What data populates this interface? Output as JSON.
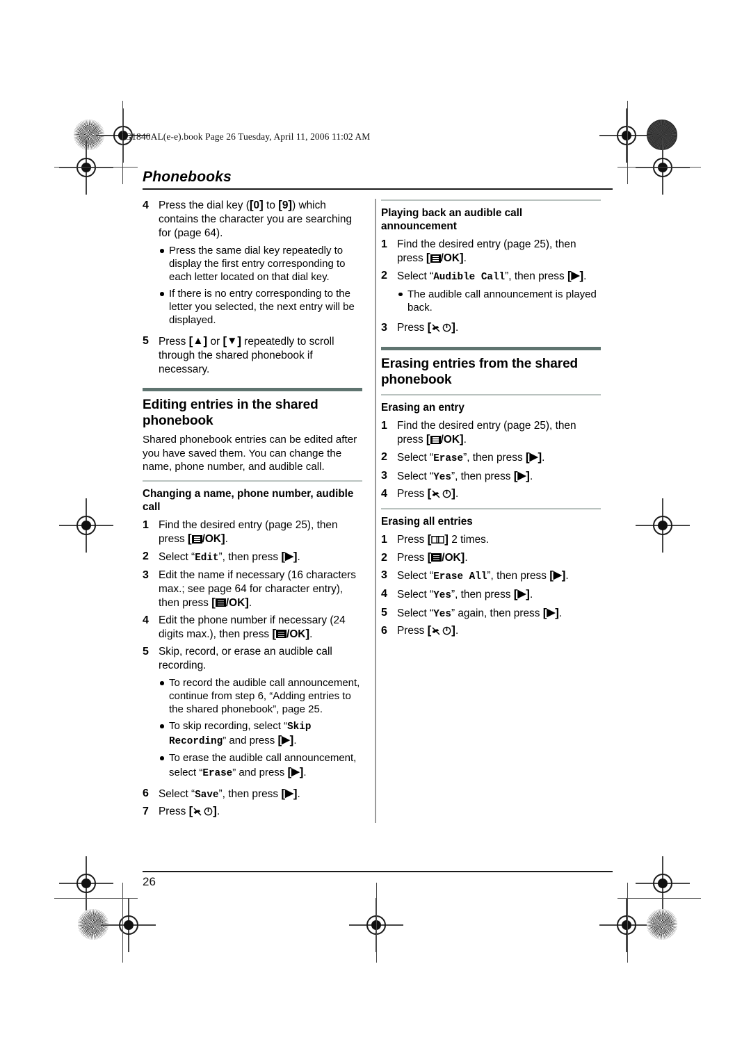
{
  "document": {
    "file_header": "TG1840AL(e-e).book  Page 26  Tuesday, April 11, 2006  11:02 AM",
    "running_head": "Phonebooks",
    "page_number": "26"
  },
  "colors": {
    "section_rule": "#5f7470",
    "sub_rule": "#b9c2bf",
    "text": "#000000",
    "column_divider": "#9a9a9a"
  },
  "left_column": {
    "continued_steps": [
      {
        "num": "4",
        "text_before": "Press the dial key (",
        "key_a": "0",
        "text_mid": " to ",
        "key_b": "9",
        "text_after": ") which contains the character you are searching for (page 64).",
        "bullets": [
          "Press the same dial key repeatedly to display the first entry corresponding to each letter located on that dial key.",
          "If there is no entry corresponding to the letter you selected, the next entry will be displayed."
        ]
      },
      {
        "num": "5",
        "text_before": "Press ",
        "text_mid": " or ",
        "text_after": " repeatedly to scroll through the shared phonebook if necessary."
      }
    ],
    "section": {
      "title": "Editing entries in the shared phonebook",
      "intro": "Shared phonebook entries can be edited after you have saved them. You can change the name, phone number, and audible call.",
      "subsection_title": "Changing a name, phone number, audible call",
      "steps": [
        {
          "num": "1",
          "before": "Find the desired entry (page 25), then press ",
          "after": "."
        },
        {
          "num": "2",
          "before": "Select “",
          "mono": "Edit",
          "mid": "”, then press ",
          "after": "."
        },
        {
          "num": "3",
          "before": "Edit the name if necessary (16 characters max.; see page 64 for character entry), then press ",
          "after": "."
        },
        {
          "num": "4",
          "before": "Edit the phone number if necessary (24 digits max.), then press ",
          "after": "."
        },
        {
          "num": "5",
          "before": "Skip, record, or erase an audible call recording.",
          "after": ""
        },
        {
          "num": "6",
          "before": "Select “",
          "mono": "Save",
          "mid": "”, then press ",
          "after": "."
        },
        {
          "num": "7",
          "before": "Press ",
          "after": "."
        }
      ],
      "step5_bullets": [
        {
          "plain": "To record the audible call announcement, continue from step 6, “Adding entries to the shared phonebook”, page 25."
        },
        {
          "before": "To skip recording, select “",
          "mono": "Skip Recording",
          "mid": "” and press ",
          "after": "."
        },
        {
          "before": "To erase the audible call announcement, select “",
          "mono": "Erase",
          "mid": "” and press ",
          "after": "."
        }
      ]
    }
  },
  "right_column": {
    "playback": {
      "subsection_title": "Playing back an audible call announcement",
      "steps": [
        {
          "num": "1",
          "before": "Find the desired entry (page 25), then press ",
          "after": "."
        },
        {
          "num": "2",
          "before": "Select “",
          "mono": "Audible Call",
          "mid": "”, then press ",
          "after": "."
        },
        {
          "num": "3",
          "before": "Press ",
          "after": "."
        }
      ],
      "step2_bullet": "The audible call announcement is played back."
    },
    "erasing": {
      "title": "Erasing entries from the shared phonebook",
      "entry_subsection_title": "Erasing an entry",
      "entry_steps": [
        {
          "num": "1",
          "before": "Find the desired entry (page 25), then press ",
          "after": "."
        },
        {
          "num": "2",
          "before": "Select “",
          "mono": "Erase",
          "mid": "”, then press ",
          "after": "."
        },
        {
          "num": "3",
          "before": "Select “",
          "mono": "Yes",
          "mid": "”, then press ",
          "after": "."
        },
        {
          "num": "4",
          "before": "Press ",
          "after": "."
        }
      ],
      "all_subsection_title": "Erasing all entries",
      "all_steps": [
        {
          "num": "1",
          "before": "Press ",
          "after": " 2 times."
        },
        {
          "num": "2",
          "before": "Press ",
          "after": "."
        },
        {
          "num": "3",
          "before": "Select “",
          "mono": "Erase All",
          "mid": "”, then press ",
          "after": "."
        },
        {
          "num": "4",
          "before": "Select “",
          "mono": "Yes",
          "mid": "”, then press ",
          "after": "."
        },
        {
          "num": "5",
          "before": "Select “",
          "mono": "Yes",
          "mid": "” again, then press ",
          "after": "."
        },
        {
          "num": "6",
          "before": "Press ",
          "after": "."
        }
      ]
    }
  },
  "glyphs": {
    "menu_ok_label": "/OK",
    "bracket_open": "[",
    "bracket_close": "]",
    "up_triangle": "▲",
    "down_triangle": "▼",
    "right_triangle": "▶"
  }
}
